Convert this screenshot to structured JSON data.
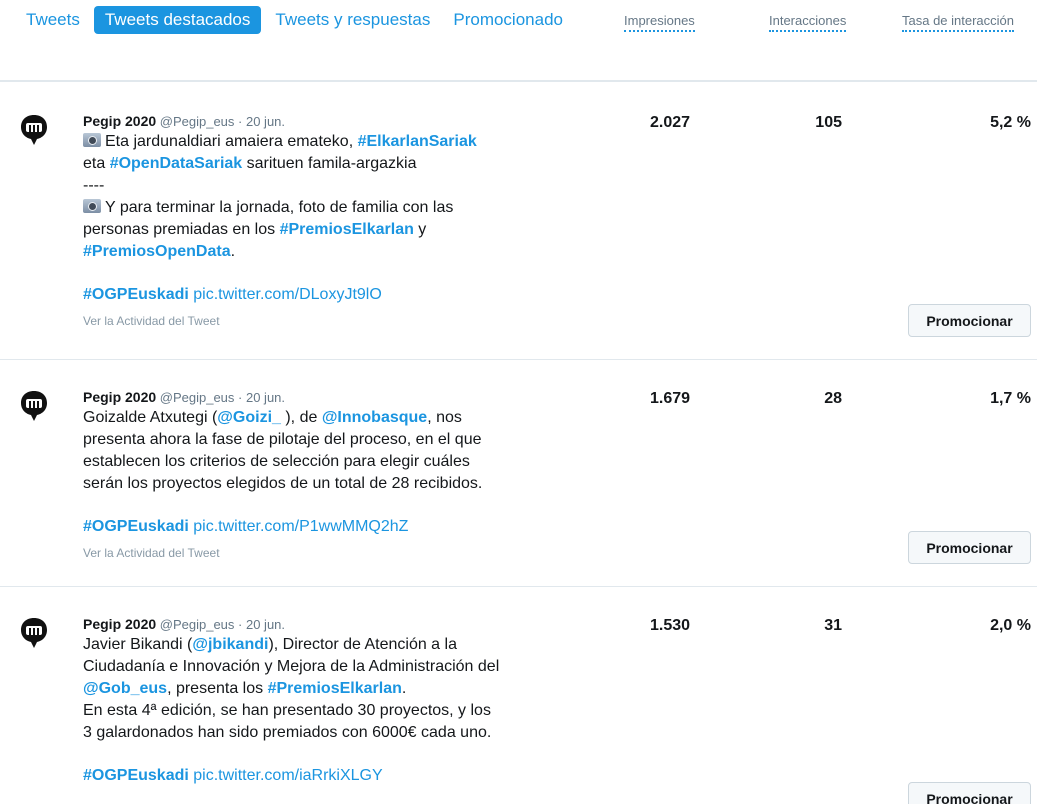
{
  "tabs": [
    {
      "label": "Tweets",
      "active": false
    },
    {
      "label": "Tweets destacados",
      "active": true
    },
    {
      "label": "Tweets y respuestas",
      "active": false
    },
    {
      "label": "Promocionado",
      "active": false
    }
  ],
  "columns": {
    "impressions": "Impresiones",
    "engagements": "Interacciones",
    "rate": "Tasa de interacción"
  },
  "tweets": [
    {
      "name": "Pegip 2020",
      "handle": "@Pegip_eus",
      "sep": " · ",
      "date": "20 jun.",
      "l1a": "Eta jardunaldiari amaiera emateko, ",
      "l1tag": "#ElkarlanSariak",
      "l2tag": "#OpenDataSariak",
      "l2pre": "eta ",
      "l2post": " sarituen famila-argazkia",
      "divider": "----",
      "l3": "Y para terminar la jornada, foto de familia con las",
      "l4a": "personas premiadas en los ",
      "l4tag": "#PremiosElkarlan",
      "l4b": " y",
      "l5tag": "#PremiosOpenData",
      "l5b": ".",
      "hashtag": "#OGPEuskadi",
      "pic": "pic.twitter.com/DLoxyJt9lO",
      "activity": "Ver la Actividad del Tweet",
      "impressions": "2.027",
      "engagements": "105",
      "rate": "5,2 %",
      "promote": "Promocionar"
    },
    {
      "name": "Pegip 2020",
      "handle": "@Pegip_eus",
      "sep": " · ",
      "date": "20 jun.",
      "l1a": "Goizalde Atxutegi (",
      "l1m1": "@Goizi_",
      "l1b": " ), de ",
      "l1m2": "@Innobasque",
      "l1c": ", nos",
      "l2": "presenta ahora la fase de pilotaje del proceso, en el que",
      "l3": "establecen los criterios de selección para elegir cuáles",
      "l4": "serán los proyectos elegidos de un total de 28 recibidos.",
      "hashtag": "#OGPEuskadi",
      "pic": "pic.twitter.com/P1wwMMQ2hZ",
      "activity": "Ver la Actividad del Tweet",
      "impressions": "1.679",
      "engagements": "28",
      "rate": "1,7 %",
      "promote": "Promocionar"
    },
    {
      "name": "Pegip 2020",
      "handle": "@Pegip_eus",
      "sep": " · ",
      "date": "20 jun.",
      "l1a": "Javier Bikandi (",
      "l1m": "@jbikandi",
      "l1b": "), Director de Atención a la",
      "l2": "Ciudadanía e Innovación y Mejora de la Administración del",
      "l3m": "@Gob_eus",
      "l3a": ", presenta los ",
      "l3tag": "#PremiosElkarlan",
      "l3b": ".",
      "l4": "En esta 4ª edición, se han presentado 30 proyectos, y los",
      "l5": "3 galardonados han sido premiados con 6000€ cada uno.",
      "hashtag": "#OGPEuskadi",
      "pic": "pic.twitter.com/iaRrkiXLGY",
      "impressions": "1.530",
      "engagements": "31",
      "rate": "2,0 %",
      "promote": "Promocionar"
    }
  ]
}
